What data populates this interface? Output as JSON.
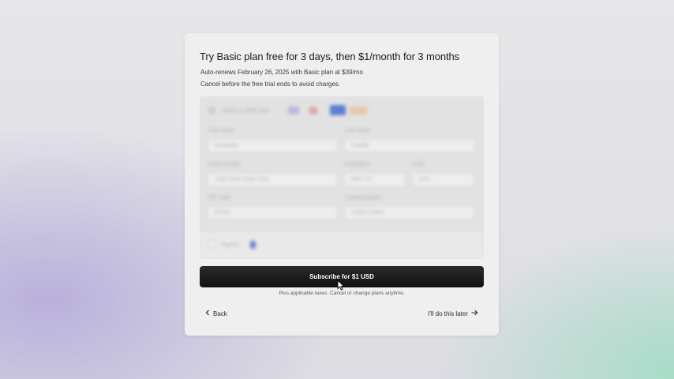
{
  "plan": {
    "title": "Try Basic plan free for 3 days, then $1/month for 3 months",
    "renews": "Auto-renews February 26, 2025 with Basic plan at $39/mo",
    "cancel_note": "Cancel before the free trial ends to avoid charges."
  },
  "form": {
    "payment_method_label": "Credit or debit card",
    "first_name_label": "First name",
    "first_name_placeholder": "Leonardo",
    "last_name_label": "Last name",
    "last_name_placeholder": "Castillo",
    "card_number_label": "Card number",
    "card_number_placeholder": "1234 1234 1234 1234",
    "expiry_label": "Expiration",
    "expiry_placeholder": "MM / YY",
    "cvc_label": "CVC",
    "cvc_placeholder": "CVC",
    "zip_label": "ZIP code",
    "zip_placeholder": "97000",
    "country_label": "Country/region",
    "country_value": "United States",
    "alt_payment_label": "PayPal"
  },
  "actions": {
    "subscribe_label": "Subscribe for $1 USD",
    "taxes_note": "Plus applicable taxes. Cancel or change plans anytime.",
    "back_label": "Back",
    "later_label": "I'll do this later"
  },
  "colors": {
    "button_bg": "#151515",
    "card_bg": "#efefef"
  }
}
